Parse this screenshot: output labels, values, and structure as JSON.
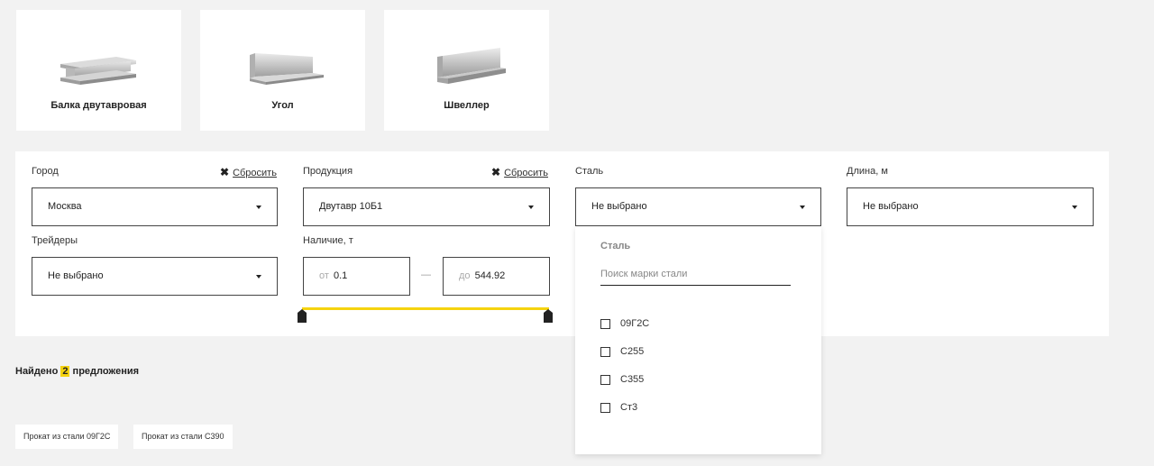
{
  "categories": [
    {
      "label": "Балка двутавровая",
      "icon": "i-beam-icon"
    },
    {
      "label": "Угол",
      "icon": "angle-profile-icon"
    },
    {
      "label": "Швеллер",
      "icon": "channel-profile-icon"
    }
  ],
  "filters": {
    "city": {
      "label": "Город",
      "value": "Москва",
      "reset": "Сбросить"
    },
    "product": {
      "label": "Продукция",
      "value": "Двутавр 10Б1",
      "reset": "Сбросить"
    },
    "steel": {
      "label": "Сталь",
      "value": "Не выбрано"
    },
    "length": {
      "label": "Длина, м",
      "value": "Не выбрано"
    },
    "traders": {
      "label": "Трейдеры",
      "value": "Не выбрано"
    },
    "availability": {
      "label": "Наличие, т",
      "from_prefix": "от",
      "from_value": "0.1",
      "separator": "—",
      "to_prefix": "до",
      "to_value": "544.92"
    }
  },
  "steel_dropdown": {
    "title": "Сталь",
    "search_placeholder": "Поиск марки стали",
    "options": [
      "09Г2С",
      "С255",
      "С355",
      "Ст3"
    ]
  },
  "results": {
    "prefix": "Найдено",
    "count": "2",
    "suffix": "предложения"
  },
  "tags": [
    "Прокат из стали 09Г2С",
    "Прокат из стали С390"
  ],
  "colors": {
    "accent": "#f5d30f",
    "background": "#f2f2f2",
    "panel": "#ffffff"
  }
}
